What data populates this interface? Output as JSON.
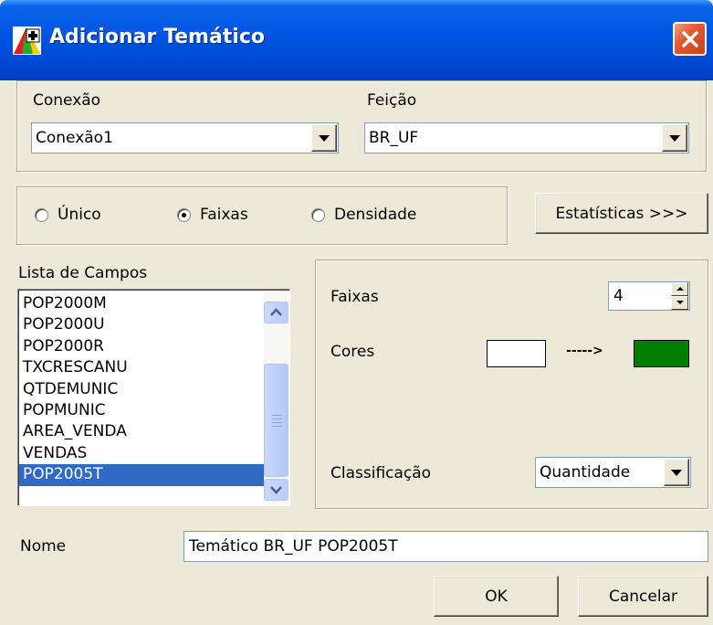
{
  "window": {
    "title": "Adicionar Temático"
  },
  "conexao": {
    "label": "Conexão",
    "value": "Conexão1"
  },
  "feicao": {
    "label": "Feição",
    "value": "BR_UF"
  },
  "mode": {
    "options": [
      "Único",
      "Faixas",
      "Densidade"
    ],
    "selected": "Faixas"
  },
  "estatisticas_button": "Estatísticas >>>",
  "campos": {
    "label": "Lista de Campos",
    "items": [
      "POP2000M",
      "POP2000U",
      "POP2000R",
      "TXCRESCANU",
      "QTDEMUNIC",
      "POPMUNIC",
      "AREA_VENDA",
      "VENDAS",
      "POP2005T"
    ],
    "selected": "POP2005T"
  },
  "faixas": {
    "label": "Faixas",
    "value": "4"
  },
  "cores": {
    "label": "Cores",
    "arrow": "----->",
    "start_color": "#ffffff",
    "end_color": "#007f00"
  },
  "classificacao": {
    "label": "Classificação",
    "value": "Quantidade"
  },
  "nome": {
    "label": "Nome",
    "value": "Temático BR_UF POP2005T"
  },
  "buttons": {
    "ok": "OK",
    "cancel": "Cancelar"
  }
}
